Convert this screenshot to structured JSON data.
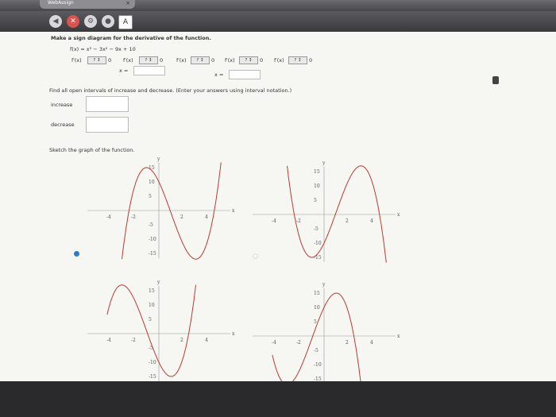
{
  "tab": {
    "title": "WebAssign"
  },
  "question1": {
    "prompt": "Make a sign diagram for the derivative of the function.",
    "function": "f(x) = x³ − 3x² − 9x + 10",
    "derivative_label": "f′(x)",
    "select_value": "? ↕",
    "zero": "0",
    "x_label": "x ="
  },
  "question2": {
    "prompt": "Find all open intervals of increase and decrease. (Enter your answers using interval notation.)",
    "increase_label": "increase",
    "decrease_label": "decrease"
  },
  "question3": {
    "prompt": "Sketch the graph of the function."
  },
  "graph": {
    "x_label": "x",
    "y_label": "y",
    "x_ticks": [
      "-4",
      "-2",
      "2",
      "4"
    ],
    "y_ticks": [
      "15",
      "10",
      "5",
      "-5",
      "-10",
      "-15"
    ]
  },
  "colors": {
    "curve": "#c0392b",
    "radio": "#2a7bd6"
  }
}
